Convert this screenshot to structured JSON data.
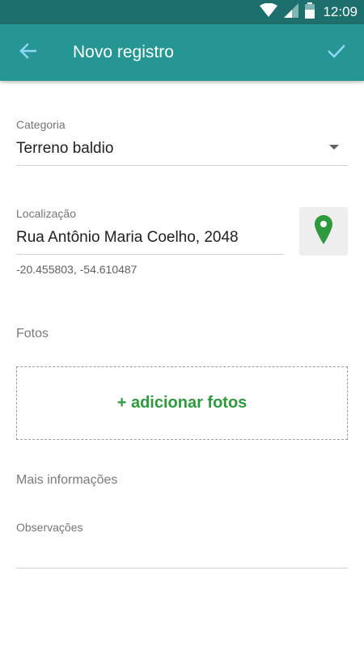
{
  "status_bar": {
    "time": "12:09",
    "icons": [
      "wifi-icon",
      "cell-signal-icon",
      "battery-icon"
    ]
  },
  "app_bar": {
    "back_icon": "arrow-left-icon",
    "title": "Novo registro",
    "confirm_icon": "check-icon"
  },
  "form": {
    "category": {
      "label": "Categoria",
      "value": "Terreno baldio",
      "icon": "dropdown-arrow-icon"
    },
    "location": {
      "label": "Localização",
      "value": "Rua Antônio Maria Coelho, 2048",
      "coordinates": "-20.455803, -54.610487",
      "map_icon": "map-pin-icon"
    },
    "photos": {
      "section_title": "Fotos",
      "add_label": "+ adicionar fotos"
    },
    "more_info": {
      "section_title": "Mais informações",
      "notes_label": "Observações",
      "notes_value": ""
    }
  },
  "colors": {
    "status_bar": "#1c6f6c",
    "app_bar": "#259693",
    "accent_light": "#8ed8f8",
    "pin_green": "#2e9a3e"
  }
}
